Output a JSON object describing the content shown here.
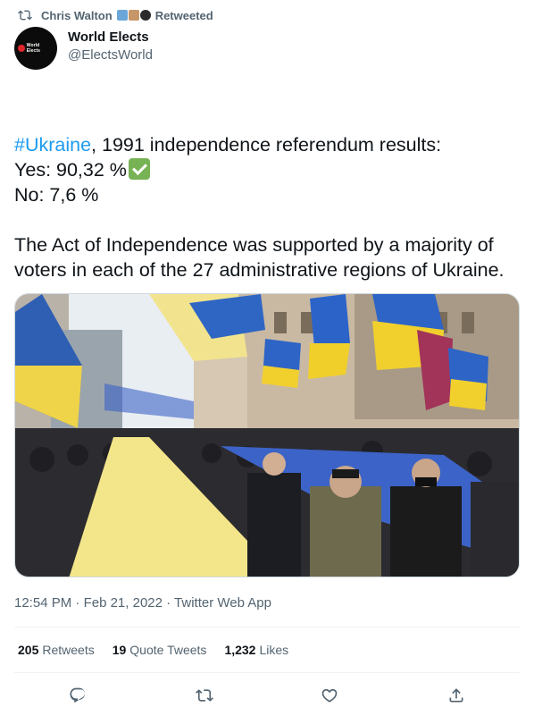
{
  "retweet": {
    "by": "Chris Walton",
    "label": "Retweeted"
  },
  "author": {
    "name": "World Elects",
    "handle": "@ElectsWorld",
    "avatar_text": "World Elects"
  },
  "tweet": {
    "line1_hashtag": "#Ukraine",
    "line1_rest": ", 1991 independence referendum results:",
    "yes": "Yes: 90,32 %",
    "no": "No: 7,6 %",
    "paragraph": "The Act of Independence was supported by a majority of voters in each of the 27 administrative regions of Ukraine."
  },
  "meta": {
    "time": "12:54 PM",
    "sep": "·",
    "date": "Feb 21, 2022",
    "client": "Twitter Web App"
  },
  "stats": [
    {
      "count": "205",
      "label": "Retweets"
    },
    {
      "count": "19",
      "label": "Quote Tweets"
    },
    {
      "count": "1,232",
      "label": "Likes"
    }
  ],
  "icons": [
    "retweet-icon",
    "reply-icon",
    "like-icon",
    "share-icon",
    "check-mark-icon",
    "ukraine-flag-icon"
  ],
  "colors": {
    "accent": "#1d9bf0",
    "muted": "#536471",
    "flag_blue": "#1f6fd0",
    "flag_yellow": "#f7cc1d"
  }
}
